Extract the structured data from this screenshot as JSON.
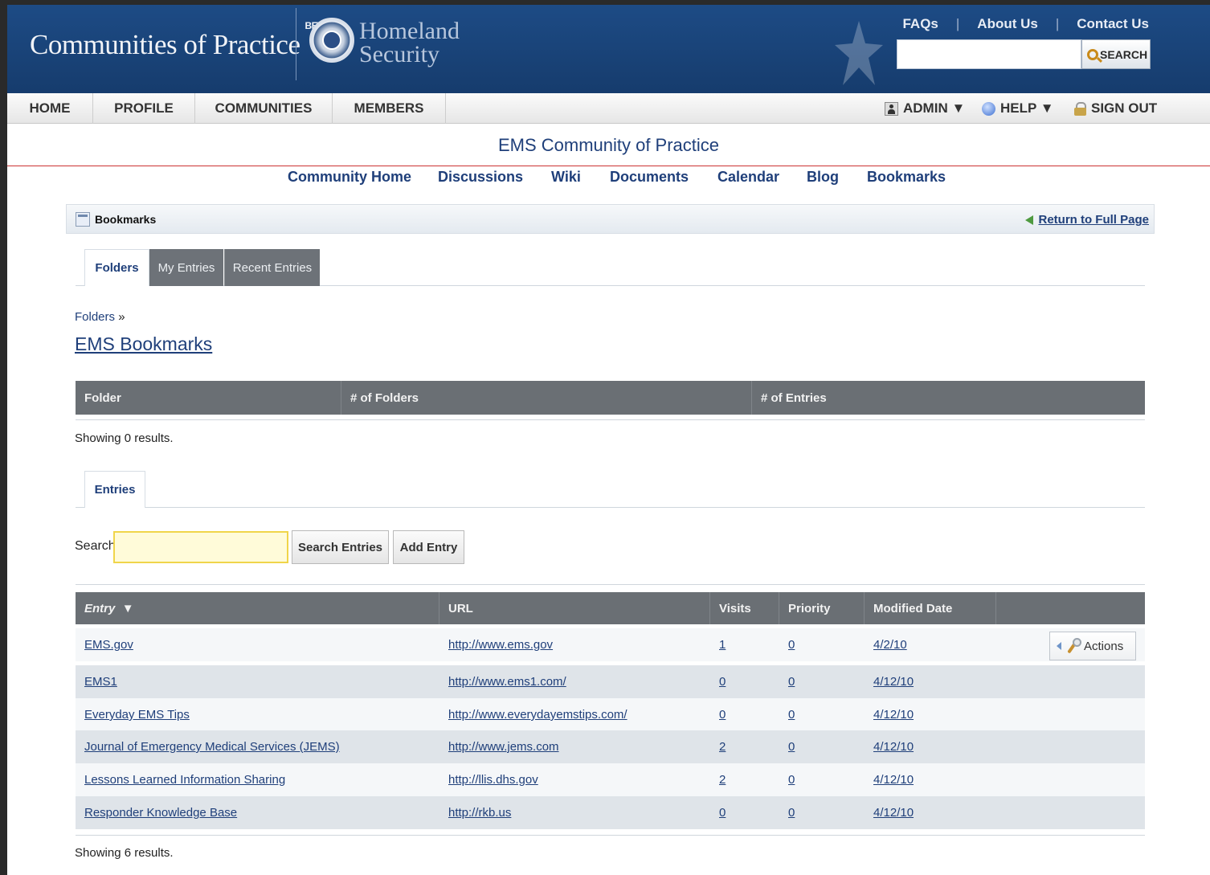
{
  "header": {
    "site_title": "Communities of Practice",
    "beta": "BETA",
    "dhs_line1": "Homeland",
    "dhs_line2": "Security",
    "links": [
      "FAQs",
      "About Us",
      "Contact Us"
    ],
    "search_placeholder": "",
    "search_button": "SEARCH"
  },
  "nav": {
    "items": [
      "HOME",
      "PROFILE",
      "COMMUNITIES",
      "MEMBERS"
    ],
    "admin": "ADMIN ▼",
    "help": "HELP ▼",
    "signout": "SIGN OUT"
  },
  "community": {
    "title": "EMS Community of Practice",
    "subnav": [
      "Community Home",
      "Discussions",
      "Wiki",
      "Documents",
      "Calendar",
      "Blog",
      "Bookmarks"
    ]
  },
  "portlet": {
    "title": "Bookmarks",
    "return_link": "Return to Full Page"
  },
  "tabs": [
    "Folders",
    "My Entries",
    "Recent Entries"
  ],
  "breadcrumb": {
    "link": "Folders",
    "sep": "»"
  },
  "folder_title": "EMS Bookmarks",
  "folders_table": {
    "columns": [
      "Folder",
      "# of Folders",
      "# of Entries"
    ],
    "showing": "Showing 0 results."
  },
  "entries_tab": "Entries",
  "entries_search": {
    "label": "Search",
    "value": "",
    "search_button": "Search Entries",
    "add_button": "Add Entry"
  },
  "entries_table": {
    "columns": [
      "Entry",
      "URL",
      "Visits",
      "Priority",
      "Modified Date"
    ],
    "sort_indicator": "▼",
    "actions_label": "Actions",
    "rows": [
      {
        "entry": "EMS.gov",
        "url": "http://www.ems.gov",
        "visits": "1",
        "priority": "0",
        "date": "4/2/10"
      },
      {
        "entry": "EMS1",
        "url": "http://www.ems1.com/",
        "visits": "0",
        "priority": "0",
        "date": "4/12/10"
      },
      {
        "entry": "Everyday EMS Tips",
        "url": "http://www.everydayemstips.com/",
        "visits": "0",
        "priority": "0",
        "date": "4/12/10"
      },
      {
        "entry": "Journal of Emergency Medical Services (JEMS)",
        "url": "http://www.jems.com",
        "visits": "2",
        "priority": "0",
        "date": "4/12/10"
      },
      {
        "entry": "Lessons Learned Information Sharing",
        "url": "http://llis.dhs.gov",
        "visits": "2",
        "priority": "0",
        "date": "4/12/10"
      },
      {
        "entry": "Responder Knowledge Base",
        "url": "http://rkb.us",
        "visits": "0",
        "priority": "0",
        "date": "4/12/10"
      }
    ],
    "showing": "Showing 6 results."
  }
}
